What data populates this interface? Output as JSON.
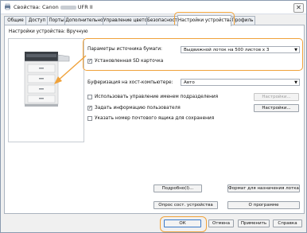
{
  "window": {
    "title_prefix": "Свойства: Canon",
    "title_suffix": "UFR II",
    "close_label": "✕"
  },
  "tabs": [
    {
      "label": "Общие"
    },
    {
      "label": "Доступ"
    },
    {
      "label": "Порты"
    },
    {
      "label": "Дополнительно"
    },
    {
      "label": "Управление цветом"
    },
    {
      "label": "Безопасность"
    },
    {
      "label": "Настройки устройства"
    },
    {
      "label": "Профиль"
    }
  ],
  "profile": {
    "label": "Настройки устройства: Вручную"
  },
  "paper_source": {
    "label": "Параметры источника бумаги:",
    "value": "Выдвижной лоток на 500 листов x 3"
  },
  "sd_card": {
    "label": "Установленная SD карточка",
    "checked": true,
    "check_glyph": "✓"
  },
  "buffering": {
    "label": "Буферизация на хост-компьютере:",
    "value": "Авто"
  },
  "options": {
    "dept_id": {
      "label": "Использовать управление именем подразделения",
      "checked": false,
      "button": "Настройки..."
    },
    "user_info": {
      "label": "Задать информацию пользователя",
      "checked": true,
      "check_glyph": "✓",
      "button": "Настройки..."
    },
    "mailbox": {
      "label": "Указать номер почтового ящика для сохранения",
      "checked": false
    }
  },
  "detail_buttons": {
    "details": "Подробно(I)...",
    "format": "Формат для назначения лотка...",
    "get_status": "Опрос сост. устройства",
    "about": "О программе"
  },
  "footer": {
    "ok": "ОК",
    "cancel": "Отмена",
    "apply": "Применить",
    "help": "Справка"
  }
}
